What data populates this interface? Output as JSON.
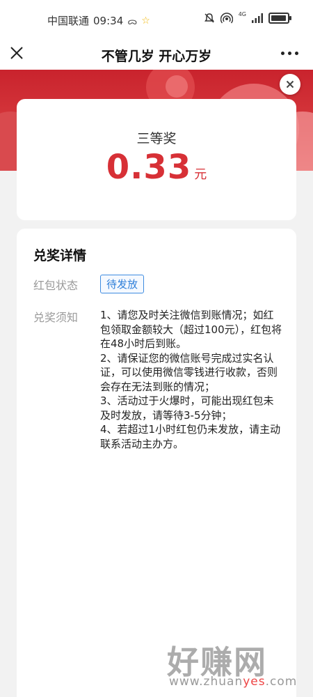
{
  "status_bar": {
    "carrier": "中国联通",
    "time": "09:34",
    "network_label": "4G"
  },
  "header": {
    "title": "不管几岁 开心万岁"
  },
  "prize": {
    "tier": "三等奖",
    "amount": "0.33",
    "unit": "元"
  },
  "details": {
    "title": "兑奖详情",
    "status_label": "红包状态",
    "status_value": "待发放",
    "notice_label": "兑奖须知",
    "notes": [
      "1、请您及时关注微信到账情况；如红包领取金额较大（超过100元），红包将在48小时后到账。",
      "2、请保证您的微信账号完成过实名认证，可以使用微信零钱进行收款，否则会存在无法到账的情况；",
      "3、活动过于火爆时，可能出现红包未及时发放，请等待3-5分钟；",
      "4、若超过1小时红包仍未发放，请主动联系活动主办方。"
    ]
  },
  "watermark": {
    "text": "好赚网",
    "url_pre": "www.zhuan",
    "url_hl": "yes",
    "url_post": ".com"
  },
  "colors": {
    "accent_red": "#d73036",
    "banner_red": "#c9232d",
    "badge_blue": "#2f7fd9"
  },
  "icons": [
    "do-not-disturb-icon",
    "star-icon",
    "mute-icon",
    "hotspot-icon",
    "signal-icon",
    "battery-icon",
    "close-icon",
    "more-icon",
    "dismiss-icon"
  ]
}
